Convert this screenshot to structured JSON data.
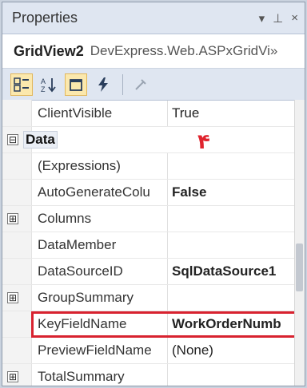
{
  "panel": {
    "title": "Properties",
    "pin_glyph": "▾ ⊥ ×"
  },
  "object": {
    "name": "GridView2",
    "type": "DevExpress.Web.ASPxGridVi»"
  },
  "toolbar": {
    "buttons": [
      "categorized-icon",
      "alphabetical-icon",
      "properties-icon",
      "events-icon",
      "property-pages-icon"
    ]
  },
  "annotation": {
    "text": "۴",
    "color": "#e0242e"
  },
  "properties": [
    {
      "name": "ClientVisible",
      "value": "True",
      "bold": false
    },
    {
      "category": "Data",
      "expander": "⊟"
    },
    {
      "name": "(Expressions)",
      "value": "",
      "bold": false
    },
    {
      "name": "AutoGenerateColu",
      "value": "False",
      "bold": true
    },
    {
      "name": "Columns",
      "value": "",
      "expander": "⊞"
    },
    {
      "name": "DataMember",
      "value": "",
      "bold": false
    },
    {
      "name": "DataSourceID",
      "value": "SqlDataSource1",
      "bold": true
    },
    {
      "name": "GroupSummary",
      "value": "",
      "expander": "⊞"
    },
    {
      "name": "KeyFieldName",
      "value": "WorkOrderNumb",
      "bold": true,
      "highlighted": true
    },
    {
      "name": "PreviewFieldName",
      "value": "(None)",
      "bold": false
    },
    {
      "name": "TotalSummary",
      "value": "",
      "expander": "⊞"
    }
  ]
}
